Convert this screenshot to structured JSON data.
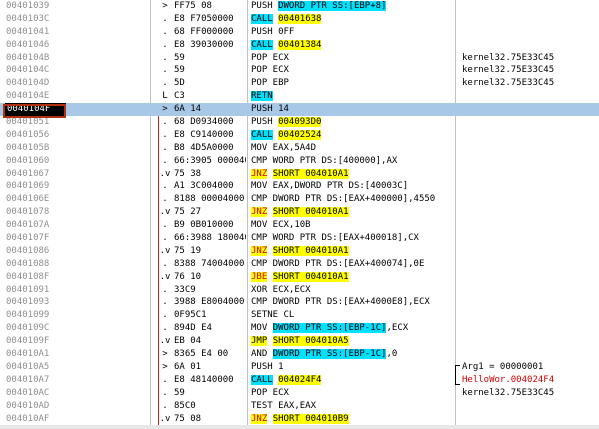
{
  "rows": [
    {
      "addr": "00401039",
      "marker": ">",
      "hex": "FF75 08",
      "cmd": [
        {
          "t": "PUSH "
        },
        {
          "t": "DWORD PTR SS:[EBP+8]",
          "c": "hl-cyan"
        }
      ],
      "comment": ""
    },
    {
      "addr": "0040103C",
      "marker": ".",
      "hex": "E8 F7050000",
      "cmd": [
        {
          "t": "CALL",
          "c": "hl-cyan"
        },
        {
          "t": " "
        },
        {
          "t": "00401638",
          "c": "hl-yellow"
        }
      ],
      "comment": ""
    },
    {
      "addr": "00401041",
      "marker": ".",
      "hex": "68 FF000000",
      "cmd": [
        {
          "t": "PUSH 0FF"
        }
      ],
      "comment": ""
    },
    {
      "addr": "00401046",
      "marker": ".",
      "hex": "E8 39030000",
      "cmd": [
        {
          "t": "CALL",
          "c": "hl-cyan"
        },
        {
          "t": " "
        },
        {
          "t": "00401384",
          "c": "hl-yellow"
        }
      ],
      "comment": ""
    },
    {
      "addr": "0040104B",
      "marker": ".",
      "hex": "59",
      "cmd": [
        {
          "t": "POP ECX"
        }
      ],
      "comment": "kernel32.75E33C45"
    },
    {
      "addr": "0040104C",
      "marker": ".",
      "hex": "59",
      "cmd": [
        {
          "t": "POP ECX"
        }
      ],
      "comment": "kernel32.75E33C45"
    },
    {
      "addr": "0040104D",
      "marker": ".",
      "hex": "5D",
      "cmd": [
        {
          "t": "POP EBP"
        }
      ],
      "comment": "kernel32.75E33C45"
    },
    {
      "addr": "0040104E",
      "marker": "L",
      "hex": "C3",
      "cmd": [
        {
          "t": "RETN",
          "c": "retn"
        }
      ],
      "comment": ""
    },
    {
      "addr": "0040104F",
      "marker": ">",
      "hex": "6A 14",
      "cmd": [
        {
          "t": "PUSH 14"
        }
      ],
      "comment": "",
      "selected": true
    },
    {
      "addr": "00401051",
      "marker": ".",
      "hex": "68 D0934000",
      "cmd": [
        {
          "t": "PUSH "
        },
        {
          "t": "004093D0",
          "c": "hl-yellow"
        }
      ],
      "comment": ""
    },
    {
      "addr": "00401056",
      "marker": ".",
      "hex": "E8 C9140000",
      "cmd": [
        {
          "t": "CALL",
          "c": "hl-cyan"
        },
        {
          "t": " "
        },
        {
          "t": "00402524",
          "c": "hl-yellow"
        }
      ],
      "comment": ""
    },
    {
      "addr": "0040105B",
      "marker": ".",
      "hex": "B8 4D5A0000",
      "cmd": [
        {
          "t": "MOV EAX,5A4D"
        }
      ],
      "comment": ""
    },
    {
      "addr": "00401060",
      "marker": ".",
      "hex": "66:3905 0000400",
      "cmd": [
        {
          "t": "CMP WORD PTR DS:[400000],AX"
        }
      ],
      "comment": ""
    },
    {
      "addr": "00401067",
      "marker": ".v",
      "hex": "75 38",
      "cmd": [
        {
          "t": "JNZ",
          "c": "hl-red"
        },
        {
          "t": " "
        },
        {
          "t": "SHORT 004010A1",
          "c": "hl-yellow"
        }
      ],
      "comment": ""
    },
    {
      "addr": "00401069",
      "marker": ".",
      "hex": "A1 3C004000",
      "cmd": [
        {
          "t": "MOV EAX,DWORD PTR DS:[40003C]"
        }
      ],
      "comment": ""
    },
    {
      "addr": "0040106E",
      "marker": ".",
      "hex": "8188 00004000",
      "cmd": [
        {
          "t": "CMP DWORD PTR DS:[EAX+400000],4550"
        }
      ],
      "comment": ""
    },
    {
      "addr": "00401078",
      "marker": ".v",
      "hex": "75 27",
      "cmd": [
        {
          "t": "JNZ",
          "c": "hl-red"
        },
        {
          "t": " "
        },
        {
          "t": "SHORT 004010A1",
          "c": "hl-yellow"
        }
      ],
      "comment": ""
    },
    {
      "addr": "0040107A",
      "marker": ".",
      "hex": "B9 0B010000",
      "cmd": [
        {
          "t": "MOV ECX,10B"
        }
      ],
      "comment": ""
    },
    {
      "addr": "0040107F",
      "marker": ".",
      "hex": "66:3988 1800400",
      "cmd": [
        {
          "t": "CMP WORD PTR DS:[EAX+400018],CX"
        }
      ],
      "comment": ""
    },
    {
      "addr": "00401086",
      "marker": ".v",
      "hex": "75 19",
      "cmd": [
        {
          "t": "JNZ",
          "c": "hl-red"
        },
        {
          "t": " "
        },
        {
          "t": "SHORT 004010A1",
          "c": "hl-yellow"
        }
      ],
      "comment": ""
    },
    {
      "addr": "00401088",
      "marker": ".",
      "hex": "8388 74004000",
      "cmd": [
        {
          "t": "CMP DWORD PTR DS:[EAX+400074],0E"
        }
      ],
      "comment": ""
    },
    {
      "addr": "0040108F",
      "marker": ".v",
      "hex": "76 10",
      "cmd": [
        {
          "t": "JBE",
          "c": "hl-red"
        },
        {
          "t": " "
        },
        {
          "t": "SHORT 004010A1",
          "c": "hl-yellow"
        }
      ],
      "comment": ""
    },
    {
      "addr": "00401091",
      "marker": ".",
      "hex": "33C9",
      "cmd": [
        {
          "t": "XOR ECX,ECX"
        }
      ],
      "comment": ""
    },
    {
      "addr": "00401093",
      "marker": ".",
      "hex": "3988 E8004000",
      "cmd": [
        {
          "t": "CMP DWORD PTR DS:[EAX+4000E8],ECX"
        }
      ],
      "comment": ""
    },
    {
      "addr": "00401099",
      "marker": ".",
      "hex": "0F95C1",
      "cmd": [
        {
          "t": "SETNE CL"
        }
      ],
      "comment": ""
    },
    {
      "addr": "0040109C",
      "marker": ".",
      "hex": "894D E4",
      "cmd": [
        {
          "t": "MOV "
        },
        {
          "t": "DWORD PTR SS:[EBP-1C]",
          "c": "hl-cyan"
        },
        {
          "t": ",ECX"
        }
      ],
      "comment": ""
    },
    {
      "addr": "0040109F",
      "marker": ".v",
      "hex": "EB 04",
      "cmd": [
        {
          "t": "JMP",
          "c": "hl-yellow"
        },
        {
          "t": " "
        },
        {
          "t": "SHORT 004010A5",
          "c": "hl-yellow"
        }
      ],
      "comment": ""
    },
    {
      "addr": "004010A1",
      "marker": ">",
      "hex": "8365 E4 00",
      "cmd": [
        {
          "t": "AND "
        },
        {
          "t": "DWORD PTR SS:[EBP-1C]",
          "c": "hl-cyan"
        },
        {
          "t": ",0"
        }
      ],
      "comment": ""
    },
    {
      "addr": "004010A5",
      "marker": ">",
      "hex": "6A 01",
      "cmd": [
        {
          "t": "PUSH 1"
        }
      ],
      "comment": "Arg1 = 00000001"
    },
    {
      "addr": "004010A7",
      "marker": ".",
      "hex": "E8 48140000",
      "cmd": [
        {
          "t": "CALL",
          "c": "hl-cyan"
        },
        {
          "t": " "
        },
        {
          "t": "004024F4",
          "c": "hl-yellow"
        }
      ],
      "comment": "HelloWor.004024F4",
      "comment_red": true
    },
    {
      "addr": "004010AC",
      "marker": ".",
      "hex": "59",
      "cmd": [
        {
          "t": "POP ECX"
        }
      ],
      "comment": "kernel32.75E33C45"
    },
    {
      "addr": "004010AD",
      "marker": ".",
      "hex": "85C0",
      "cmd": [
        {
          "t": "TEST EAX,EAX"
        }
      ],
      "comment": ""
    },
    {
      "addr": "004010AF",
      "marker": ".v",
      "hex": "75 08",
      "cmd": [
        {
          "t": "JNZ",
          "c": "hl-red"
        },
        {
          "t": " "
        },
        {
          "t": "SHORT 004010B9",
          "c": "hl-yellow"
        }
      ],
      "comment": ""
    }
  ]
}
